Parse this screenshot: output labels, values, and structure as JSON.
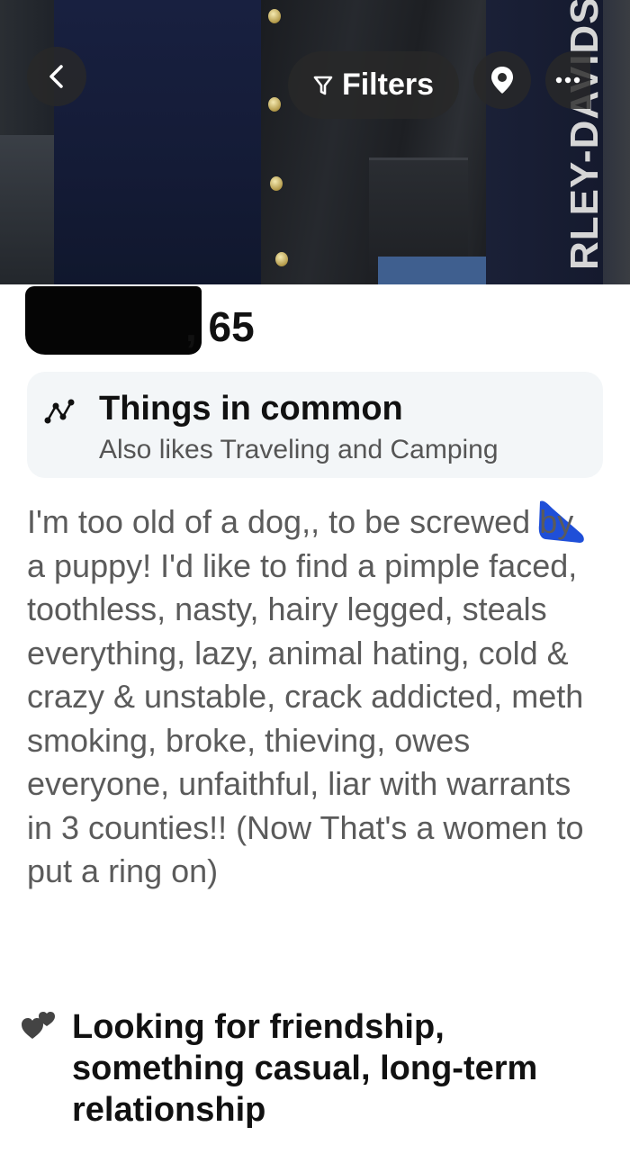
{
  "header": {
    "filters_label": "Filters",
    "photo_sleeve_text": "RLEY-DAVIDSON"
  },
  "profile": {
    "age_text": ", 65"
  },
  "common": {
    "title": "Things in common",
    "subtitle": "Also likes Traveling and Camping"
  },
  "bio": "I'm too old of a dog,, to be screwed by a puppy! I'd like to find a pimple faced, toothless, nasty, hairy legged, steals everything, lazy, animal hating, cold & crazy & unstable, crack addicted, meth smoking, broke, thieving, owes everyone, unfaithful, liar with warrants in 3 counties!! (Now That's a women to put a ring on)",
  "looking_for": "Looking for friendship, something casual, long-term relationship",
  "colors": {
    "accent_blue": "#1f4fd8",
    "button_bg": "#2b2b2b",
    "card_bg": "#f3f6f8"
  }
}
